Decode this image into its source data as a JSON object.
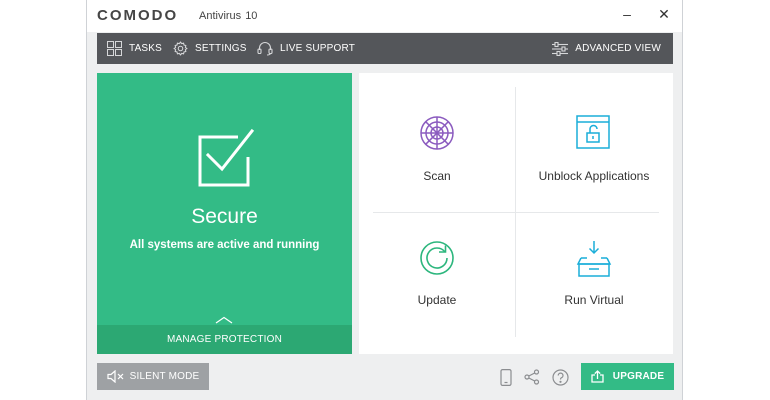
{
  "app": {
    "brand": "COMODO",
    "product": "Antivirus",
    "version": "10"
  },
  "window_controls": {
    "minimize": "–",
    "close": "✕"
  },
  "toolbar": {
    "tasks": "TASKS",
    "settings": "SETTINGS",
    "live_support": "LIVE SUPPORT",
    "advanced_view": "ADVANCED VIEW"
  },
  "status": {
    "title": "Secure",
    "subtitle": "All systems are active and running",
    "manage": "MANAGE PROTECTION",
    "color": "#33bb86"
  },
  "actions": [
    {
      "label": "Scan",
      "icon": "scan-radar-icon",
      "color": "#8b5bbf"
    },
    {
      "label": "Unblock Applications",
      "icon": "unblock-window-icon",
      "color": "#1aaed9"
    },
    {
      "label": "Update",
      "icon": "update-refresh-icon",
      "color": "#2cb67d"
    },
    {
      "label": "Run Virtual",
      "icon": "run-virtual-box-icon",
      "color": "#1aaed9"
    }
  ],
  "footer": {
    "silent_mode": "SILENT MODE",
    "upgrade": "UPGRADE"
  }
}
